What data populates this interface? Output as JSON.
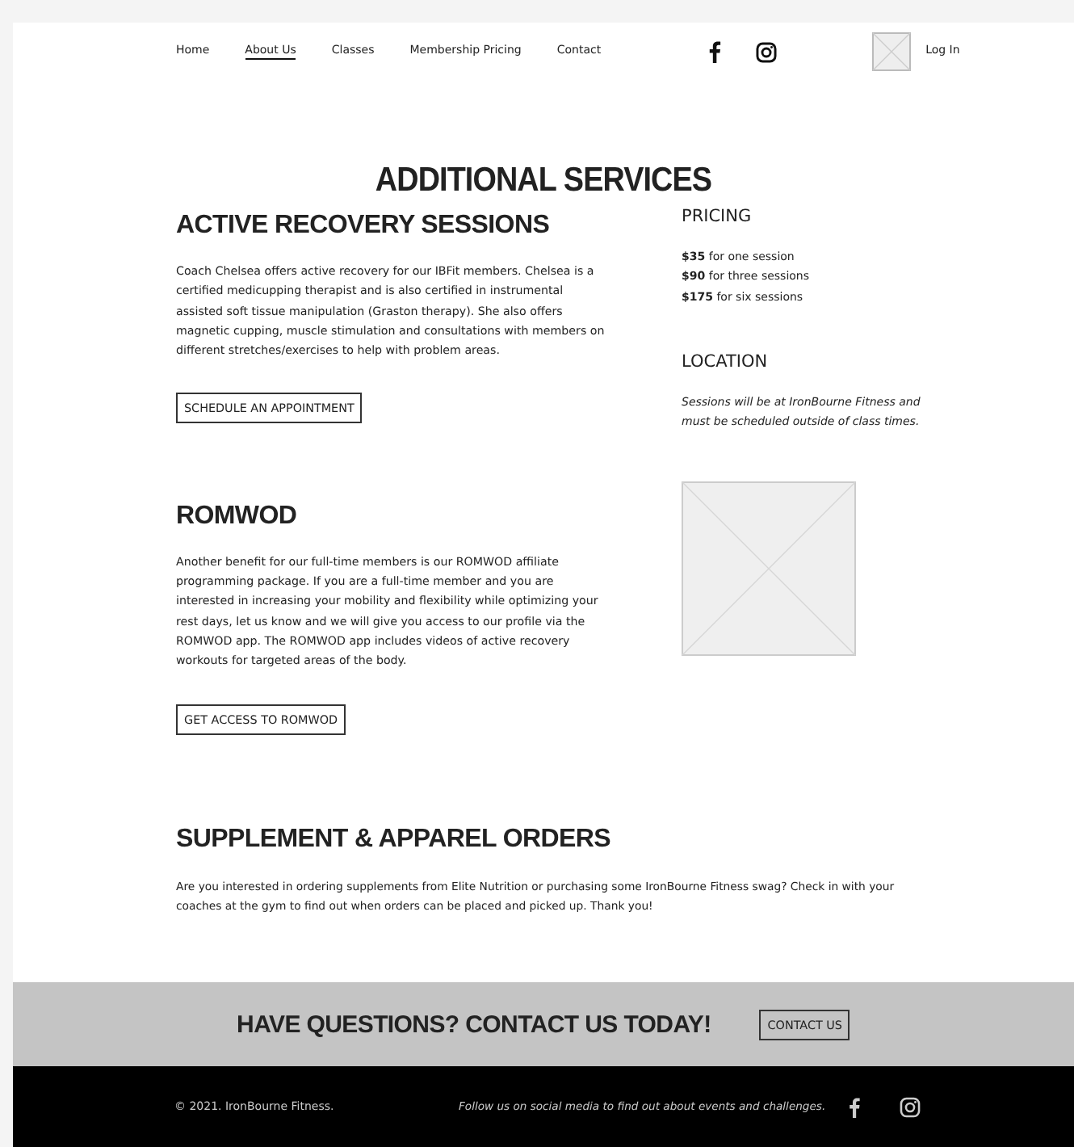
{
  "nav": {
    "links": [
      {
        "label": "Home",
        "selected": false
      },
      {
        "label": "About Us",
        "selected": true
      },
      {
        "label": "Classes",
        "selected": false
      },
      {
        "label": "Membership Pricing",
        "selected": false
      },
      {
        "label": "Contact",
        "selected": false
      }
    ],
    "login": "Log In"
  },
  "page_title": "ADDITIONAL SERVICES",
  "recovery": {
    "heading": "ACTIVE RECOVERY SESSIONS",
    "body": "Coach Chelsea offers active recovery for our IBFit members. Chelsea is a certified medicupping therapist and is also certified in instrumental assisted soft tissue manipulation (Graston therapy). She also offers magnetic cupping, muscle stimulation and consultations with members on different stretches/exercises to help with problem areas.",
    "button": "SCHEDULE AN APPOINTMENT"
  },
  "pricing": {
    "heading": "PRICING",
    "lines": [
      "**$35** for one session",
      "**$90** for three sessions",
      "**$175** for six sessions"
    ]
  },
  "location": {
    "heading": "LOCATION",
    "text": "Sessions will be at IronBourne Fitness and must be scheduled outside of class times."
  },
  "romwod": {
    "heading": "ROMWOD",
    "body": "Another benefit for our full-time members is our ROMWOD affiliate programming package. If you are a full-time member and you are interested in increasing your mobility and flexibility while optimizing your rest days, let us know and we will give you access to our profile via the ROMWOD app. The ROMWOD app includes videos of active recovery workouts for targeted areas of the body.",
    "button": "GET ACCESS TO ROMWOD"
  },
  "orders": {
    "heading": "SUPPLEMENT & APPAREL ORDERS",
    "body": "Are you interested in ordering supplements from Elite Nutrition or purchasing some IronBourne Fitness swag? Check in with your coaches at the gym to find out when orders can be placed and picked up. Thank you!"
  },
  "cta": {
    "heading": "HAVE QUESTIONS? CONTACT US TODAY!",
    "button": "CONTACT US"
  },
  "footer": {
    "copyright": "© 2021. IronBourne Fitness.",
    "social_text": "Follow us on social media to find out about events and challenges."
  }
}
